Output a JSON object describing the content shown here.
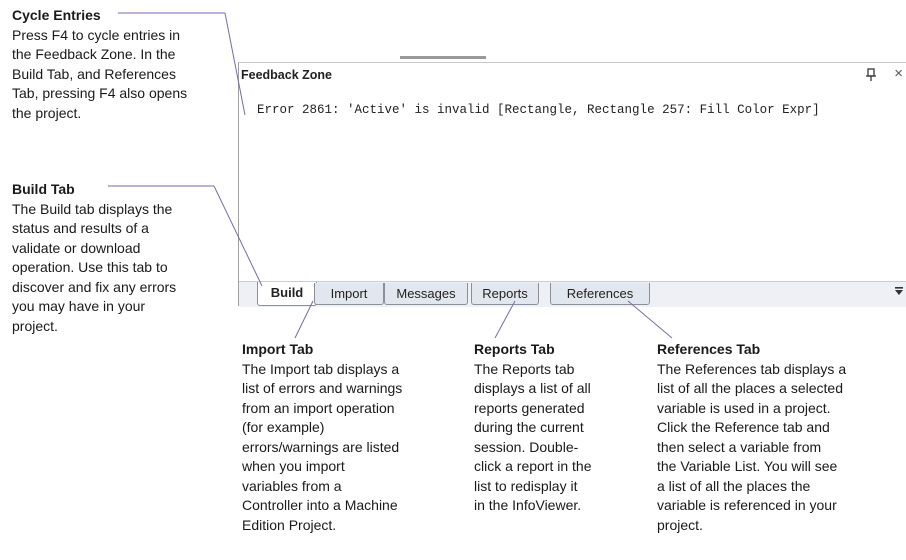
{
  "callouts": {
    "cycle_entries": {
      "title": "Cycle Entries",
      "body": "Press F4 to cycle entries in\nthe Feedback Zone. In the\nBuild Tab, and References\nTab, pressing F4 also opens\nthe project."
    },
    "build_tab": {
      "title": "Build Tab",
      "body": "The Build tab displays the\nstatus and results of a\nvalidate or download\noperation. Use this tab to\ndiscover and fix any errors\nyou may have in your\nproject."
    },
    "import_tab": {
      "title": "Import Tab",
      "body": "The Import tab displays a\nlist of errors and warnings\nfrom an import operation\n(for example)\nerrors/warnings are listed\nwhen you import\nvariables from a\nController into a Machine\nEdition Project."
    },
    "reports_tab": {
      "title": "Reports Tab",
      "body": "The Reports tab\ndisplays a list of all\nreports generated\nduring the current\nsession. Double-\nclick a report in the\nlist to redisplay it\nin the InfoViewer."
    },
    "references_tab": {
      "title": "References Tab",
      "body": "The References tab displays a\nlist of all the places a selected\nvariable is used in a project.\nClick the Reference tab and\nthen select a variable from\nthe Variable List. You will see\na list of all the places the\nvariable is referenced in your\nproject."
    }
  },
  "panel": {
    "title": "Feedback Zone",
    "close_glyph": "×",
    "error_line": "Error 2861: 'Active' is invalid [Rectangle, Rectangle 257: Fill Color Expr]",
    "tabs": [
      {
        "label": "Build",
        "active": true
      },
      {
        "label": "Import",
        "active": false
      },
      {
        "label": "Messages",
        "active": false
      },
      {
        "label": "Reports",
        "active": false
      },
      {
        "label": "References",
        "active": false
      }
    ]
  },
  "icons": [
    "pin-icon",
    "close-icon",
    "tab-overflow-icon"
  ],
  "colors": {
    "leader_line": "#7b6aa8",
    "active_tab_bg": "#ffffff",
    "tab_bg": "#e2e6ee"
  }
}
